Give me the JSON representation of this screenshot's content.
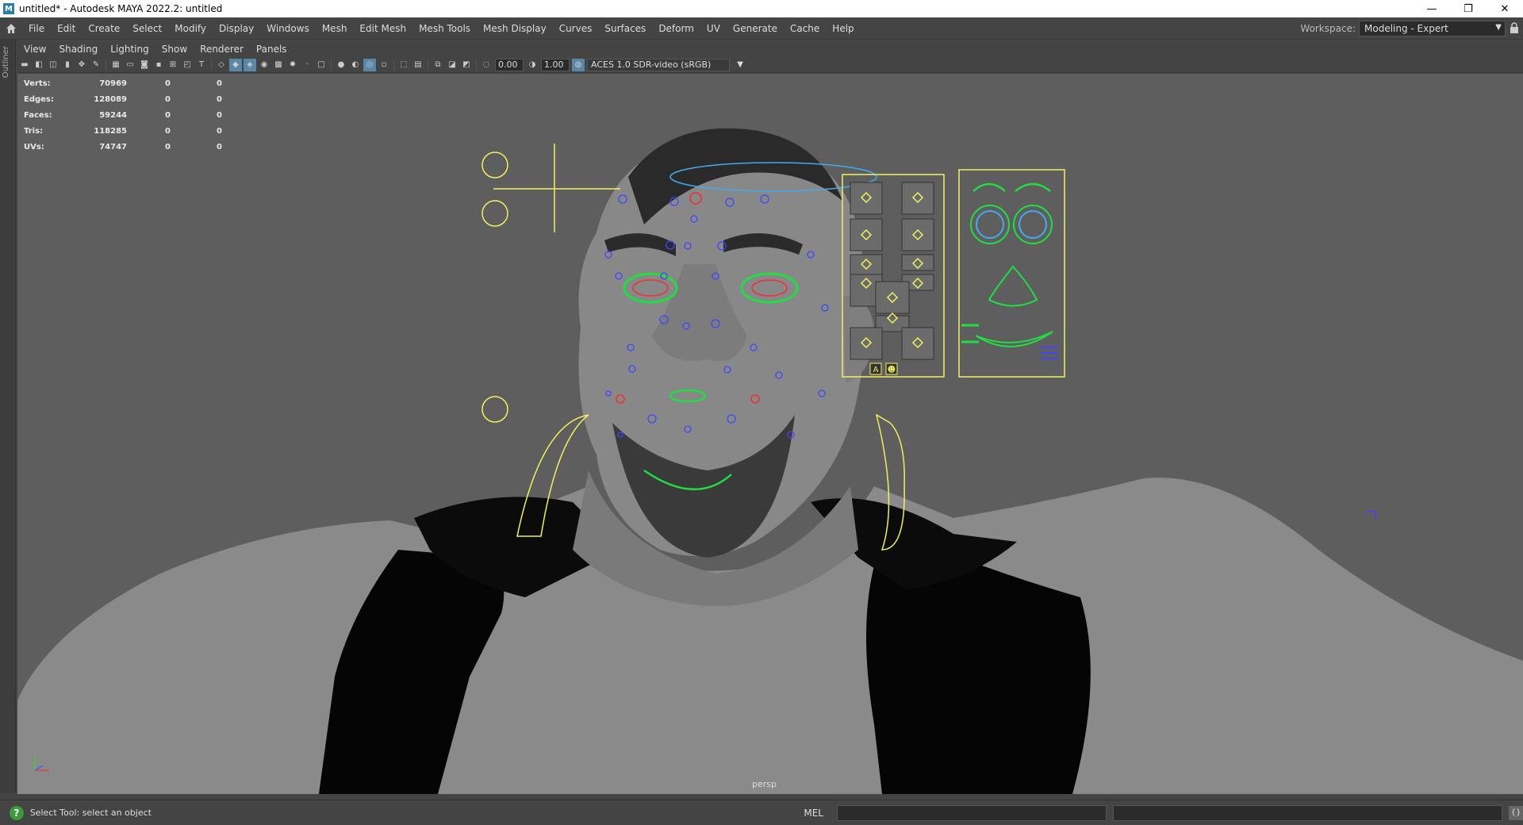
{
  "window": {
    "title": "untitled* - Autodesk MAYA 2022.2: untitled",
    "app_icon": "M",
    "minimize": "—",
    "restore": "❐",
    "close": "✕"
  },
  "menubar": {
    "items": [
      "File",
      "Edit",
      "Create",
      "Select",
      "Modify",
      "Display",
      "Windows",
      "Mesh",
      "Edit Mesh",
      "Mesh Tools",
      "Mesh Display",
      "Curves",
      "Surfaces",
      "Deform",
      "UV",
      "Generate",
      "Cache",
      "Help"
    ],
    "workspace_label": "Workspace:",
    "workspace_value": "Modeling - Expert"
  },
  "outliner": {
    "label": "Outliner"
  },
  "panel_menu": [
    "View",
    "Shading",
    "Lighting",
    "Show",
    "Renderer",
    "Panels"
  ],
  "toolbar": {
    "exposure": "0.00",
    "gamma": "1.00",
    "color_space": "ACES 1.0 SDR-video (sRGB)"
  },
  "hud": {
    "rows": [
      {
        "label": "Verts:",
        "v1": "70969",
        "v2": "0",
        "v3": "0"
      },
      {
        "label": "Edges:",
        "v1": "128089",
        "v2": "0",
        "v3": "0"
      },
      {
        "label": "Faces:",
        "v1": "59244",
        "v2": "0",
        "v3": "0"
      },
      {
        "label": "Tris:",
        "v1": "118285",
        "v2": "0",
        "v3": "0"
      },
      {
        "label": "UVs:",
        "v1": "74747",
        "v2": "0",
        "v3": "0"
      }
    ]
  },
  "viewport": {
    "camera": "persp",
    "panel_button_labels": [
      "A",
      "☻"
    ]
  },
  "statusbar": {
    "help_text": "Select Tool: select an object",
    "mel_label": "MEL"
  },
  "colors": {
    "viewport_bg": "#5e5e5e",
    "control_yellow": "#f0f060",
    "control_green": "#22dd44",
    "control_blue": "#4444ff",
    "control_red": "#ee3030",
    "control_cyan": "#44aaee"
  }
}
